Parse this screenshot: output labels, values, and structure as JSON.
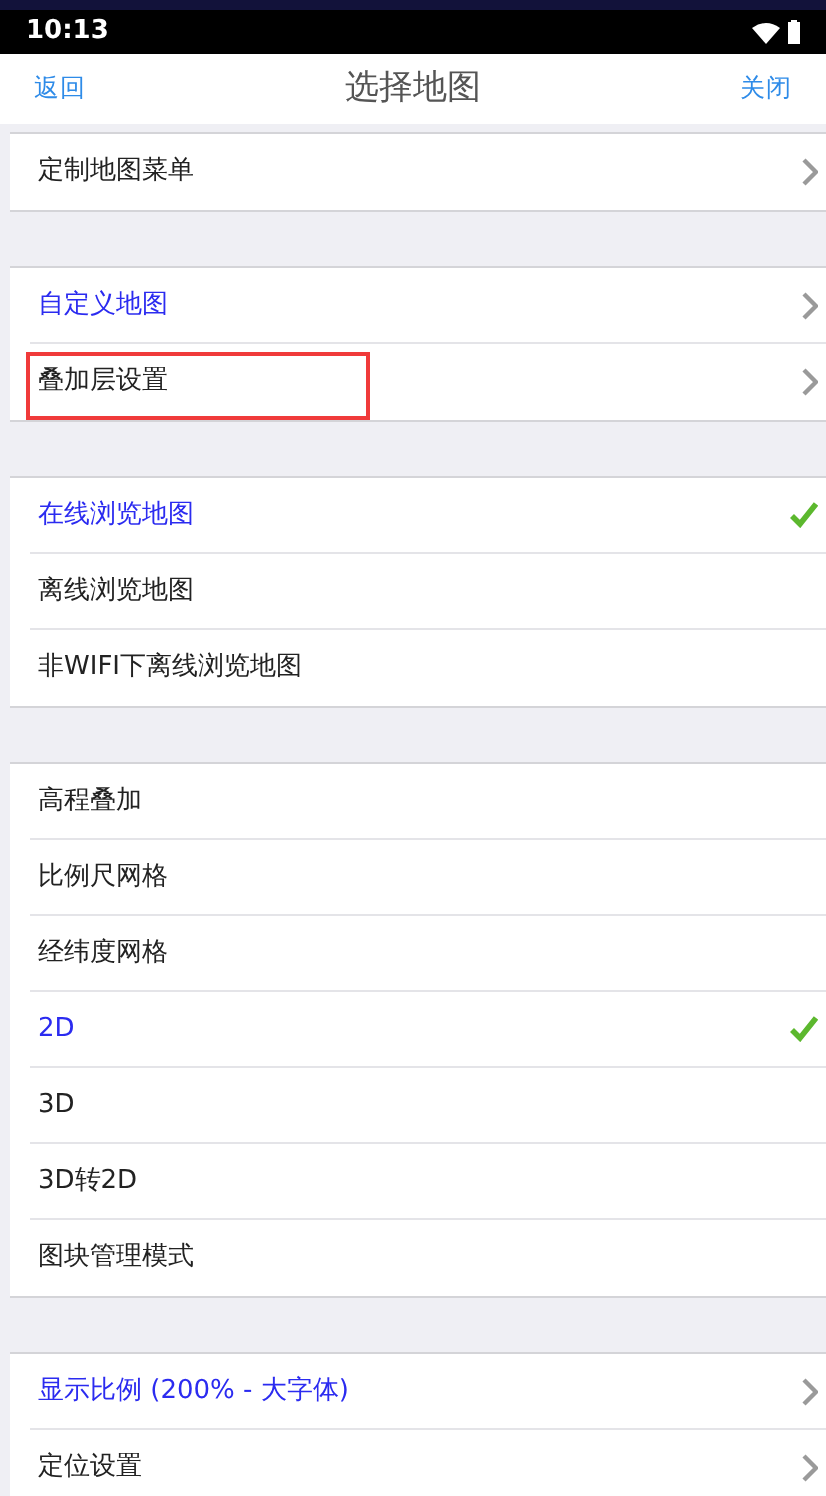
{
  "status_bar": {
    "time": "10:13"
  },
  "header": {
    "back": "返回",
    "title": "选择地图",
    "close": "关闭"
  },
  "sections": [
    {
      "items": [
        {
          "label": "定制地图菜单",
          "kind": "link",
          "accent": false,
          "highlighted": false
        }
      ]
    },
    {
      "items": [
        {
          "label": "自定义地图",
          "kind": "link",
          "accent": true,
          "highlighted": false
        },
        {
          "label": "叠加层设置",
          "kind": "link",
          "accent": false,
          "highlighted": true
        }
      ]
    },
    {
      "items": [
        {
          "label": "在线浏览地图",
          "kind": "option",
          "selected": true
        },
        {
          "label": "离线浏览地图",
          "kind": "option",
          "selected": false
        },
        {
          "label": "非WIFI下离线浏览地图",
          "kind": "option",
          "selected": false
        }
      ]
    },
    {
      "items": [
        {
          "label": "高程叠加",
          "kind": "option",
          "selected": false
        },
        {
          "label": "比例尺网格",
          "kind": "option",
          "selected": false
        },
        {
          "label": "经纬度网格",
          "kind": "option",
          "selected": false
        },
        {
          "label": "2D",
          "kind": "option",
          "selected": true
        },
        {
          "label": "3D",
          "kind": "option",
          "selected": false
        },
        {
          "label": "3D转2D",
          "kind": "option",
          "selected": false
        },
        {
          "label": "图块管理模式",
          "kind": "option",
          "selected": false
        }
      ]
    },
    {
      "items": [
        {
          "label": "显示比例 (200% - 大字体)",
          "kind": "link",
          "accent": true,
          "highlighted": false
        },
        {
          "label": "定位设置",
          "kind": "link",
          "accent": false,
          "highlighted": false
        }
      ]
    }
  ]
}
